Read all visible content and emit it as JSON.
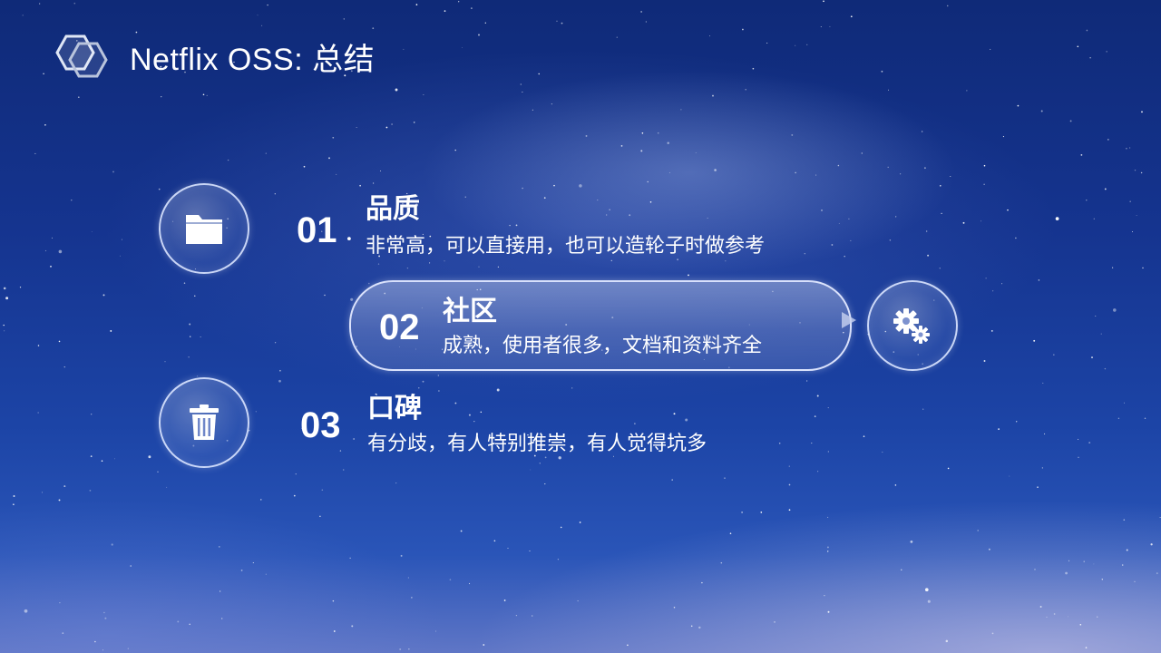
{
  "slide": {
    "title": "Netflix OSS: 总结"
  },
  "icons": {
    "logo": "hexagon-logo-icon",
    "item1": "folder-icon",
    "item2": "gears-icon",
    "item3": "trash-icon"
  },
  "items": [
    {
      "number": "01",
      "title": "品质",
      "description": "非常高，可以直接用，也可以造轮子时做参考"
    },
    {
      "number": "02",
      "title": "社区",
      "description": "成熟，使用者很多，文档和资料齐全"
    },
    {
      "number": "03",
      "title": "口碑",
      "description": "有分歧，有人特别推崇，有人觉得坑多"
    }
  ],
  "colors": {
    "background_top": "#0f2a78",
    "background_bottom": "#5f76c6",
    "text": "#ffffff",
    "outline": "#dce6ff"
  }
}
